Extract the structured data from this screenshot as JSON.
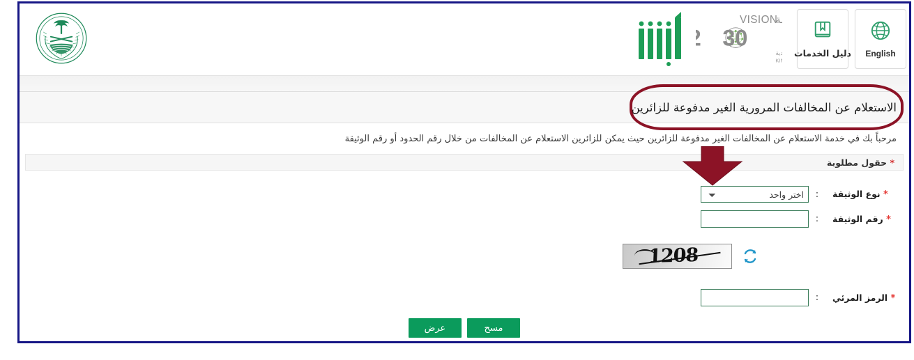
{
  "header": {
    "emblem_alt": "moi-emblem",
    "buttons": [
      {
        "id": "english",
        "label": "English",
        "icon": "globe-icon"
      },
      {
        "id": "services-guide",
        "label": "دليل الخدمات",
        "icon": "book-icon"
      }
    ],
    "vision_logo": {
      "arabic_word": "رؤيــــة",
      "english_word": "VISION",
      "year": "2030",
      "kingdom_ar": "المملكة العربية السعودية",
      "kingdom_en": "KINGDOM OF SAUDI ARABIA"
    },
    "absher_logo": {
      "name": "absher-logo"
    }
  },
  "page": {
    "title": "الاستعلام عن المخالفات المرورية الغير مدفوعة للزائرين",
    "description": "مرحباً بك في خدمة الاستعلام عن المخالفات الغير مدفوعة للزائرين حيث يمكن للزائرين الاستعلام عن المخالفات من خلال رقم الحدود أو رقم الوثيقة",
    "required_fields_note": "حقول مطلوبة",
    "required_star": "*"
  },
  "form": {
    "colon": ":",
    "fields": [
      {
        "id": "document-type",
        "label": "نوع الوثيقة",
        "star": "*",
        "type": "select",
        "value": "اختر واحد",
        "options": [
          "اختر واحد"
        ]
      },
      {
        "id": "document-number",
        "label": "رقم الوثيقة",
        "star": "*",
        "type": "text",
        "value": "",
        "placeholder": ""
      },
      {
        "id": "visual-code",
        "label": "الرمز المرئي",
        "star": "*",
        "type": "text",
        "value": "",
        "placeholder": ""
      }
    ],
    "captcha": {
      "code": "1208",
      "refresh_icon": "refresh-icon"
    },
    "buttons": [
      {
        "id": "view",
        "label": "عرض"
      },
      {
        "id": "clear",
        "label": "مسح"
      }
    ]
  },
  "annotations": {
    "title_highlight": {
      "name": "title-ellipse-annotation",
      "color": "#8c1326"
    },
    "dropdown_arrow": {
      "name": "down-arrow-annotation",
      "color": "#8c1326"
    },
    "outer_frame": {
      "name": "screenshot-frame-annotation",
      "color": "#161685"
    }
  },
  "colors": {
    "brand_green": "#0b9b5c",
    "field_border_green": "#3b7d5a",
    "annotation_red": "#8c1326",
    "annotation_navy": "#161685",
    "required_star_red": "#e53935"
  }
}
